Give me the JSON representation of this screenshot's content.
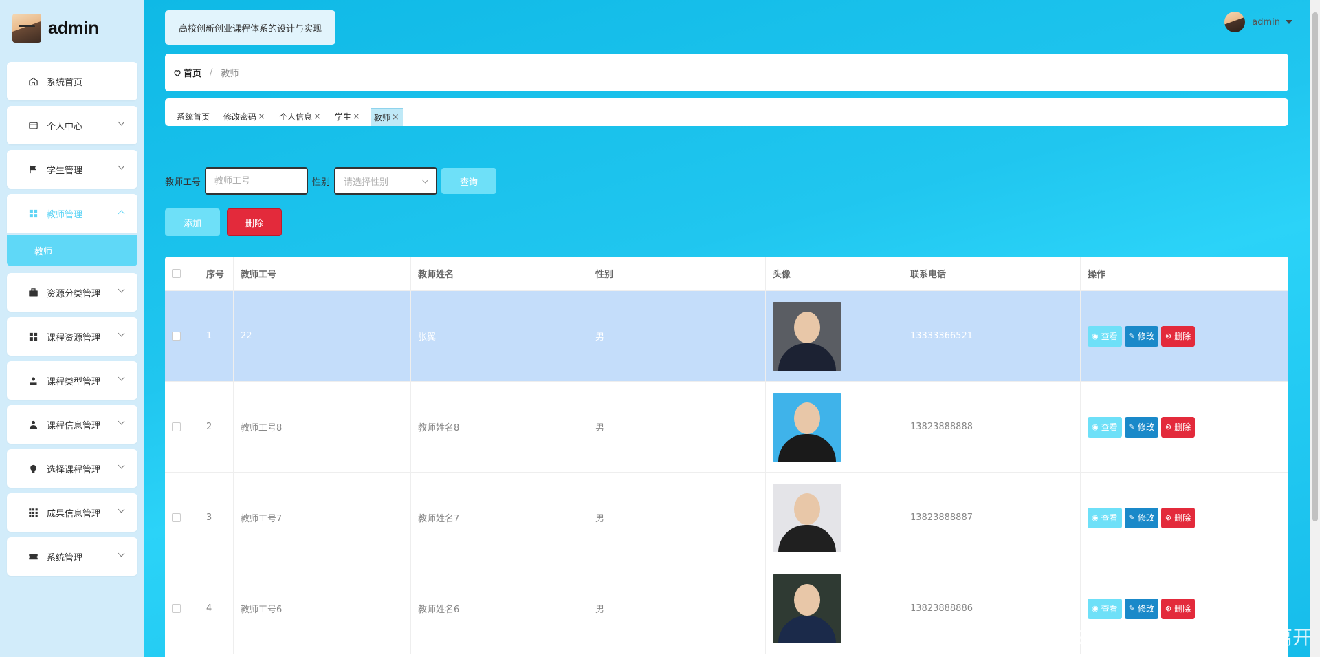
{
  "brand": {
    "name": "admin"
  },
  "sidebar": {
    "items": [
      {
        "label": "系统首页",
        "icon": "home-icon",
        "has_children": false
      },
      {
        "label": "个人中心",
        "icon": "card-icon",
        "has_children": true
      },
      {
        "label": "学生管理",
        "icon": "flag-icon",
        "has_children": true
      },
      {
        "label": "教师管理",
        "icon": "grid-icon",
        "has_children": true,
        "active": true
      },
      {
        "label": "资源分类管理",
        "icon": "briefcase-icon",
        "has_children": true
      },
      {
        "label": "课程资源管理",
        "icon": "grid-icon",
        "has_children": true
      },
      {
        "label": "课程类型管理",
        "icon": "user-icon",
        "has_children": true
      },
      {
        "label": "课程信息管理",
        "icon": "person-icon",
        "has_children": true
      },
      {
        "label": "选择课程管理",
        "icon": "bulb-icon",
        "has_children": true
      },
      {
        "label": "成果信息管理",
        "icon": "apps-icon",
        "has_children": true
      },
      {
        "label": "系统管理",
        "icon": "ticket-icon",
        "has_children": true
      }
    ],
    "active_sub": "教师"
  },
  "header": {
    "site_title": "高校创新创业课程体系的设计与实现",
    "user": "admin"
  },
  "breadcrumb": {
    "home": "首页",
    "separator": "/",
    "current": "教师"
  },
  "tags": [
    {
      "label": "系统首页",
      "closable": false
    },
    {
      "label": "修改密码",
      "closable": true
    },
    {
      "label": "个人信息",
      "closable": true
    },
    {
      "label": "学生",
      "closable": true
    },
    {
      "label": "教师",
      "closable": true,
      "active": true
    }
  ],
  "close_glyph": "×",
  "search": {
    "id_label": "教师工号",
    "id_placeholder": "教师工号",
    "gender_label": "性别",
    "gender_placeholder": "请选择性别",
    "query_button": "查询"
  },
  "actions": {
    "add": "添加",
    "delete": "删除"
  },
  "table": {
    "columns": [
      "序号",
      "教师工号",
      "教师姓名",
      "性别",
      "头像",
      "联系电话",
      "操作"
    ],
    "rows": [
      {
        "index": "1",
        "id": "22",
        "name": "张翼",
        "gender": "男",
        "phone": "13333366521",
        "photo_bg": "#5a5d63",
        "photo_fg": "#1c2233"
      },
      {
        "index": "2",
        "id": "教师工号8",
        "name": "教师姓名8",
        "gender": "男",
        "phone": "13823888888",
        "photo_bg": "#3fb3ea",
        "photo_fg": "#1a1a1a"
      },
      {
        "index": "3",
        "id": "教师工号7",
        "name": "教师姓名7",
        "gender": "男",
        "phone": "13823888887",
        "photo_bg": "#e4e4e8",
        "photo_fg": "#202020"
      },
      {
        "index": "4",
        "id": "教师工号6",
        "name": "教师姓名6",
        "gender": "男",
        "phone": "13823888886",
        "photo_bg": "#2f3a33",
        "photo_fg": "#1b2a4a"
      }
    ],
    "op_labels": {
      "view": "查看",
      "edit": "修改",
      "delete": "删除"
    }
  },
  "watermark": "CSDN @不要满是遗憾的离开",
  "colors": {
    "accent": "#5fd4f5",
    "danger": "#e32a3b",
    "edit": "#1a89c9"
  }
}
